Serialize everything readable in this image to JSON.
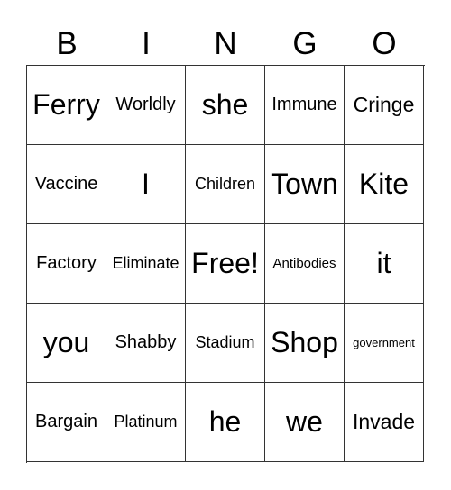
{
  "header": [
    "B",
    "I",
    "N",
    "G",
    "O"
  ],
  "cells": [
    "Ferry",
    "Worldly",
    "she",
    "Immune",
    "Cringe",
    "Vaccine",
    "I",
    "Children",
    "Town",
    "Kite",
    "Factory",
    "Eliminate",
    "Free!",
    "Antibodies",
    "it",
    "you",
    "Shabby",
    "Stadium",
    "Shop",
    "government",
    "Bargain",
    "Platinum",
    "he",
    "we",
    "Invade"
  ]
}
